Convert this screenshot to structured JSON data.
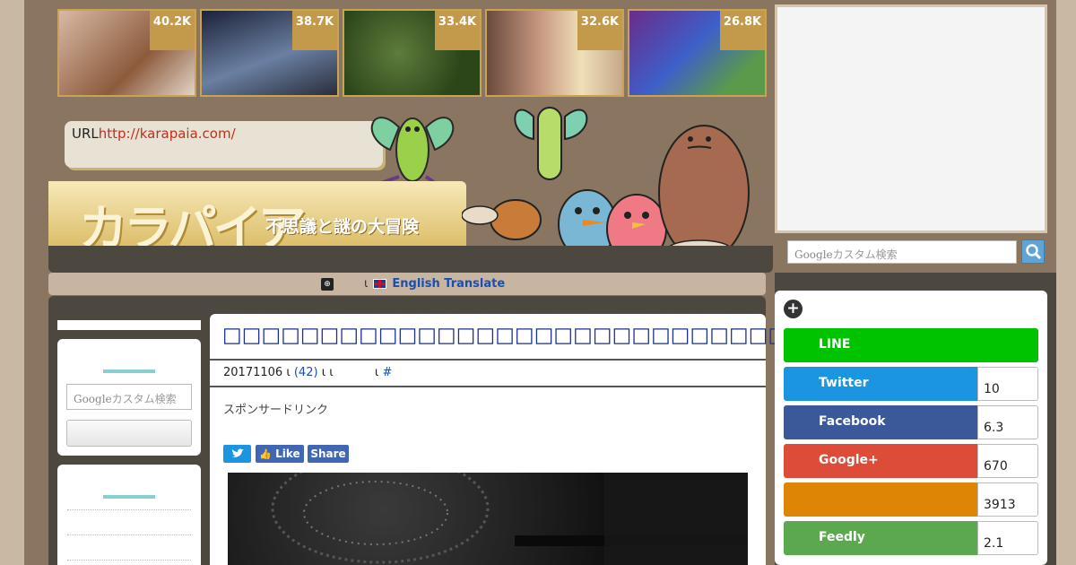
{
  "thumbnails": [
    {
      "count": "40.2K",
      "bg": "#b48a6a"
    },
    {
      "count": "38.7K",
      "bg": "#3f4866"
    },
    {
      "count": "33.4K",
      "bg": "#3c5a2a"
    },
    {
      "count": "32.6K",
      "bg": "#9a6a50"
    },
    {
      "count": "26.8K",
      "bg": "#5b2f7a"
    }
  ],
  "header": {
    "url_label": "URL",
    "url_link": "http://karapaia.com/",
    "logo": "カラパイア",
    "tagline": "不思議と謎の大冒険"
  },
  "translate": {
    "separator1": "ι",
    "link": "English Translate"
  },
  "search": {
    "placeholder_brand": "Google",
    "placeholder_text": "カスタム検索"
  },
  "post": {
    "title": "□□□□□□□□□□□□□□□□□□□□□□□□□□□□□□□□□□□□□□□",
    "date": "20171106",
    "sep": "ι",
    "comments": "(42)",
    "sep2": "ι ι",
    "sep3": "ι",
    "hash": "#",
    "sponsor": "スポンサードリンク",
    "tweet_label": "",
    "like_label": "Like",
    "share_label": "Share"
  },
  "share": {
    "plus": "+",
    "rows": [
      {
        "label": "LINE",
        "count": "",
        "color": "#00c300"
      },
      {
        "label": "Twitter",
        "count": "10",
        "color": "#1b95e0"
      },
      {
        "label": "Facebook",
        "count": "6.3",
        "color": "#3b5998"
      },
      {
        "label": "Google+",
        "count": "670",
        "color": "#dd4b39"
      },
      {
        "label": "",
        "count": "3913",
        "color": "#de8505"
      },
      {
        "label": "Feedly",
        "count": "2.1",
        "color": "#5ca84f"
      }
    ]
  },
  "colors": {
    "accent": "#c39a4c",
    "teal": "#8acfd0",
    "title": "#1b2f8c"
  }
}
